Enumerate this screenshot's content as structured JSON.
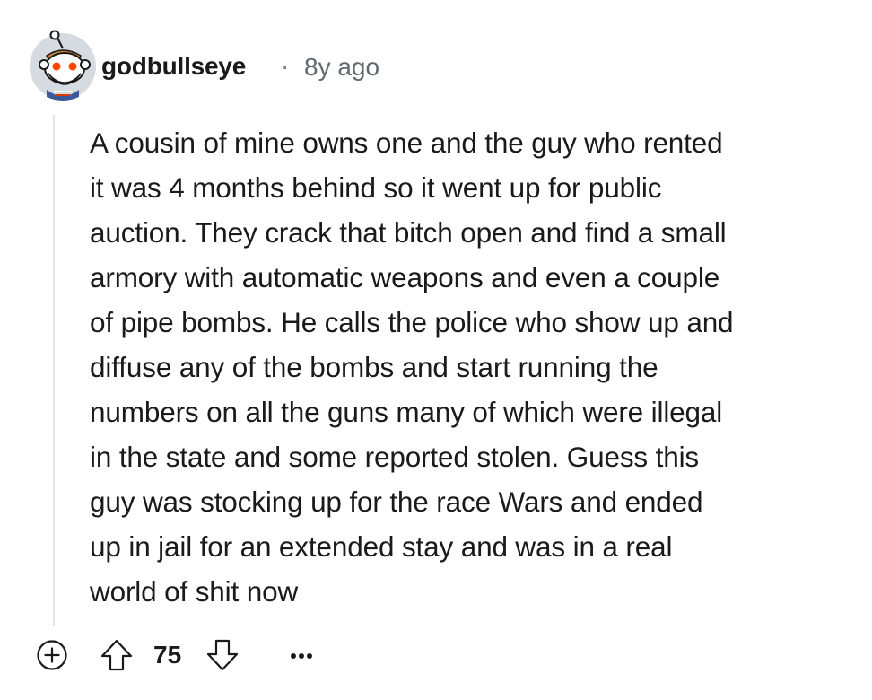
{
  "comment": {
    "author": "godbullseye",
    "separator": "·",
    "timestamp": "8y ago",
    "avatar_icon": "snoo-avatar-icon",
    "body_lines": [
      "A cousin of mine owns one and the guy who rented",
      "it was 4 months behind so it went up for public",
      "auction. They crack that bitch open and find a small",
      "armory with automatic weapons and even a couple",
      "of pipe bombs. He calls the police who show up and",
      "diffuse any of the bombs and start running the",
      "numbers on all the guns many of which were illegal",
      "in the state and some reported stolen. Guess this",
      "guy was stocking up for the race Wars and ended",
      "up in jail for an extended stay and was in a real",
      "world of shit now"
    ]
  },
  "actions": {
    "expand_icon": "plus-circle-icon",
    "upvote_icon": "arrow-up-icon",
    "score": "75",
    "downvote_icon": "arrow-down-icon",
    "more_icon": "ellipsis-icon"
  },
  "colors": {
    "text": "#1a1a1b",
    "meta": "#5f6b6f",
    "thread_line": "#e5e7e8",
    "avatar_bg": "#d5dbe0"
  }
}
